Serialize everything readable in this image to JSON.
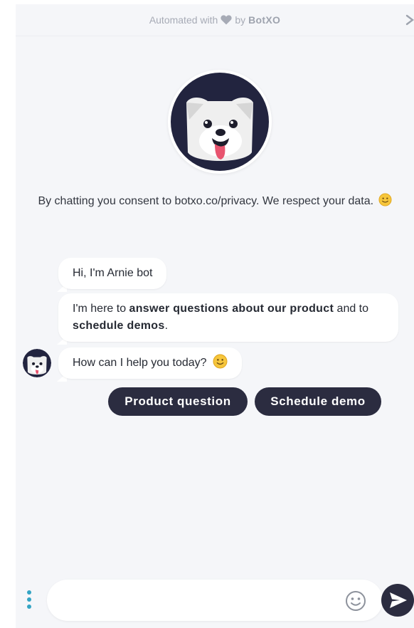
{
  "header": {
    "automated_text": "Automated with",
    "by_text": "by",
    "brand": "BotXO",
    "close_glyph": "›"
  },
  "consent": {
    "text": "By chatting you consent to botxo.co/privacy. We respect your data."
  },
  "messages": {
    "m1": "Hi, I'm Arnie bot",
    "m2_part1": "I'm here to ",
    "m2_bold1": "answer questions about our product",
    "m2_part2": " and to ",
    "m2_bold2": "schedule demos",
    "m2_part3": ".",
    "m3": "How can I help you today?"
  },
  "quick_replies": [
    "Product question",
    "Schedule demo"
  ],
  "composer": {
    "placeholder": "",
    "value": ""
  },
  "icons": {
    "heart": "heart-icon",
    "close": "close-icon",
    "menu": "menu-dots-icon",
    "emoji": "emoji-icon",
    "send": "send-icon"
  },
  "colors": {
    "accent": "#2b2c40",
    "menu_dots": "#34a4c4",
    "background": "#f5f6f9"
  }
}
